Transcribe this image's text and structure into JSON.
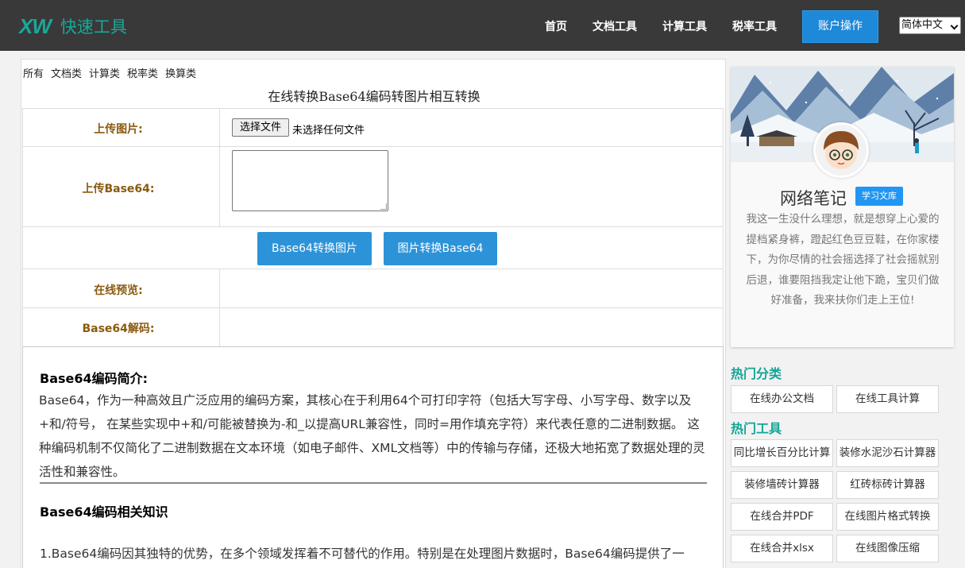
{
  "header": {
    "logo_mark": "XW",
    "logo_text": "快速工具",
    "nav": [
      "首页",
      "文档工具",
      "计算工具",
      "税率工具"
    ],
    "account_button": "账户操作",
    "language": "简体中文"
  },
  "main": {
    "categories": [
      "所有",
      "文档类",
      "计算类",
      "税率类",
      "换算类"
    ],
    "title": "在线转换Base64编码转图片相互转换",
    "labels": {
      "upload_image": "上传图片:",
      "upload_base64": "上传Base64:",
      "preview": "在线预览:",
      "decode": "Base64解码:"
    },
    "file_button": "选择文件",
    "file_none": "未选择任何文件",
    "buttons": [
      "Base64转换图片",
      "图片转换Base64"
    ]
  },
  "article": {
    "heading1": "Base64编码简介:",
    "para1": "Base64，作为一种高效且广泛应用的编码方案，其核心在于利用64个可打印字符（包括大写字母、小写字母、数字以及+和/符号， 在某些实现中+和/可能被替换为-和_以提高URL兼容性，同时=用作填充字符）来代表任意的二进制数据。 这种编码机制不仅简化了二进制数据在文本环境（如电子邮件、XML文档等）中的传输与存储，还极大地拓宽了数据处理的灵活性和兼容性。",
    "heading2": "Base64编码相关知识",
    "para2": "1.Base64编码因其独特的优势，在多个领域发挥着不可替代的作用。特别是在处理图片数据时，Base64编码提供了一"
  },
  "sidebar": {
    "profile_name": "网络笔记",
    "profile_badge": "学习文库",
    "profile_bio": "我这一生没什么理想，就是想穿上心爱的提档紧身裤，蹬起红色豆豆鞋，在你家楼下，为你尽情的社会摇选择了社会摇就别后退，谁要阻挡我定让他下跪，宝贝们做好准备，我来扶你们走上王位!",
    "hot_categories_title": "热门分类",
    "hot_categories": [
      "在线办公文档",
      "在线工具计算"
    ],
    "hot_tools_title": "热门工具",
    "hot_tools": [
      "同比增长百分比计算",
      "装修水泥沙石计算器",
      "装修墙砖计算器",
      "红砖标砖计算器",
      "在线合并PDF",
      "在线图片格式转换",
      "在线合并xlsx",
      "在线图像压缩"
    ]
  }
}
